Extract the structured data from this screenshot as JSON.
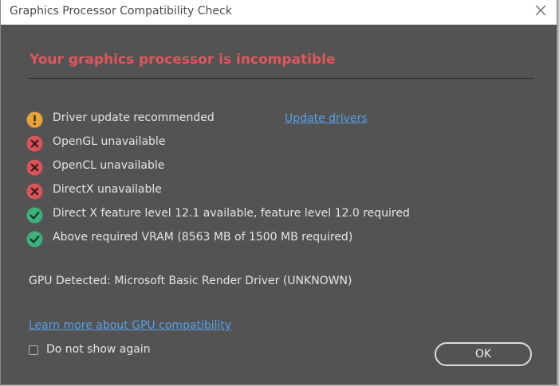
{
  "window": {
    "title": "Graphics Processor Compatibility Check"
  },
  "dialog": {
    "heading": "Your graphics processor is incompatible",
    "checks": [
      {
        "status": "warning",
        "icon": "warning-icon",
        "label": "Driver update recommended",
        "action": "Update drivers"
      },
      {
        "status": "error",
        "icon": "error-icon",
        "label": "OpenGL unavailable"
      },
      {
        "status": "error",
        "icon": "error-icon",
        "label": "OpenCL unavailable"
      },
      {
        "status": "error",
        "icon": "error-icon",
        "label": "DirectX unavailable"
      },
      {
        "status": "ok",
        "icon": "check-icon",
        "label": "Direct X feature level 12.1 available, feature level 12.0 required"
      },
      {
        "status": "ok",
        "icon": "check-icon",
        "label": "Above required VRAM (8563 MB of 1500 MB required)"
      }
    ],
    "gpu_detected": "GPU Detected: Microsoft Basic Render Driver (UNKNOWN)",
    "learn_more_link": "Learn more about GPU compatibility",
    "do_not_show_label": "Do not show again",
    "do_not_show_checked": false,
    "ok_label": "OK"
  },
  "colors": {
    "heading": "#e0565b",
    "warning": "#e8a33a",
    "error": "#d9545a",
    "ok": "#3fb07a",
    "link": "#57a1e8",
    "background": "#535353"
  }
}
